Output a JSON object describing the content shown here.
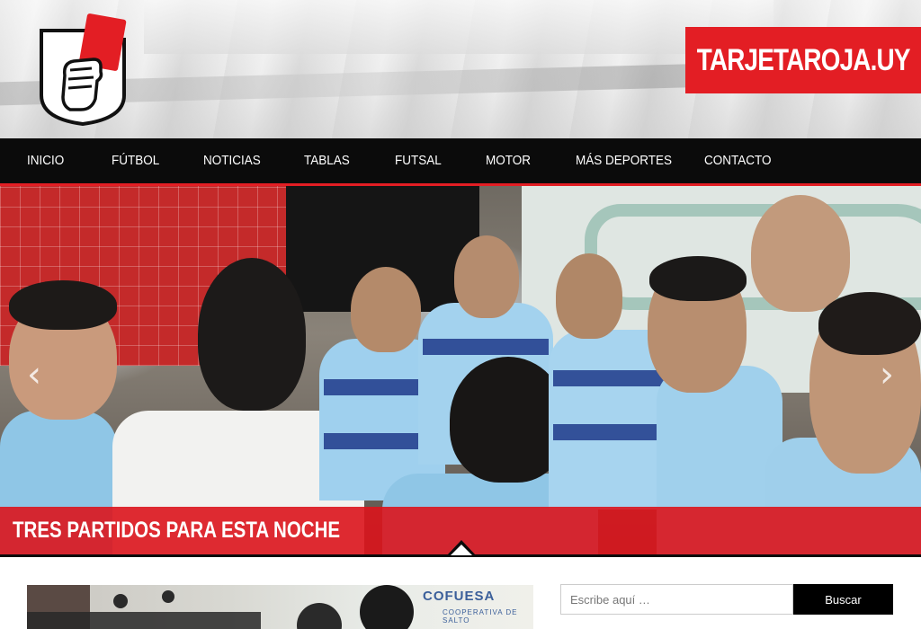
{
  "site": {
    "title": "TARJETAROJA.UY",
    "logo_icon": "red-card-hand-shield-icon",
    "colors": {
      "brand_red": "#e31e24",
      "nav_bg": "#0b0b0b",
      "white": "#ffffff"
    }
  },
  "nav": {
    "items": [
      {
        "label": "INICIO"
      },
      {
        "label": "FÚTBOL"
      },
      {
        "label": "NOTICIAS"
      },
      {
        "label": "TABLAS"
      },
      {
        "label": "FUTSAL"
      },
      {
        "label": "MOTOR"
      },
      {
        "label": "MÁS DEPORTES"
      },
      {
        "label": "CONTACTO"
      }
    ]
  },
  "slider": {
    "caption": "TRES PARTIDOS PARA ESTA NOCHE",
    "prev_icon": "chevron-left-icon",
    "next_icon": "chevron-right-icon",
    "prev_glyph": "‹",
    "next_glyph": "›"
  },
  "post_thumbnail": {
    "brand_text": "COFUESA",
    "brand_subtext": "COOPERATIVA DE SALTO"
  },
  "search": {
    "placeholder": "Escribe aquí …",
    "button_label": "Buscar"
  }
}
